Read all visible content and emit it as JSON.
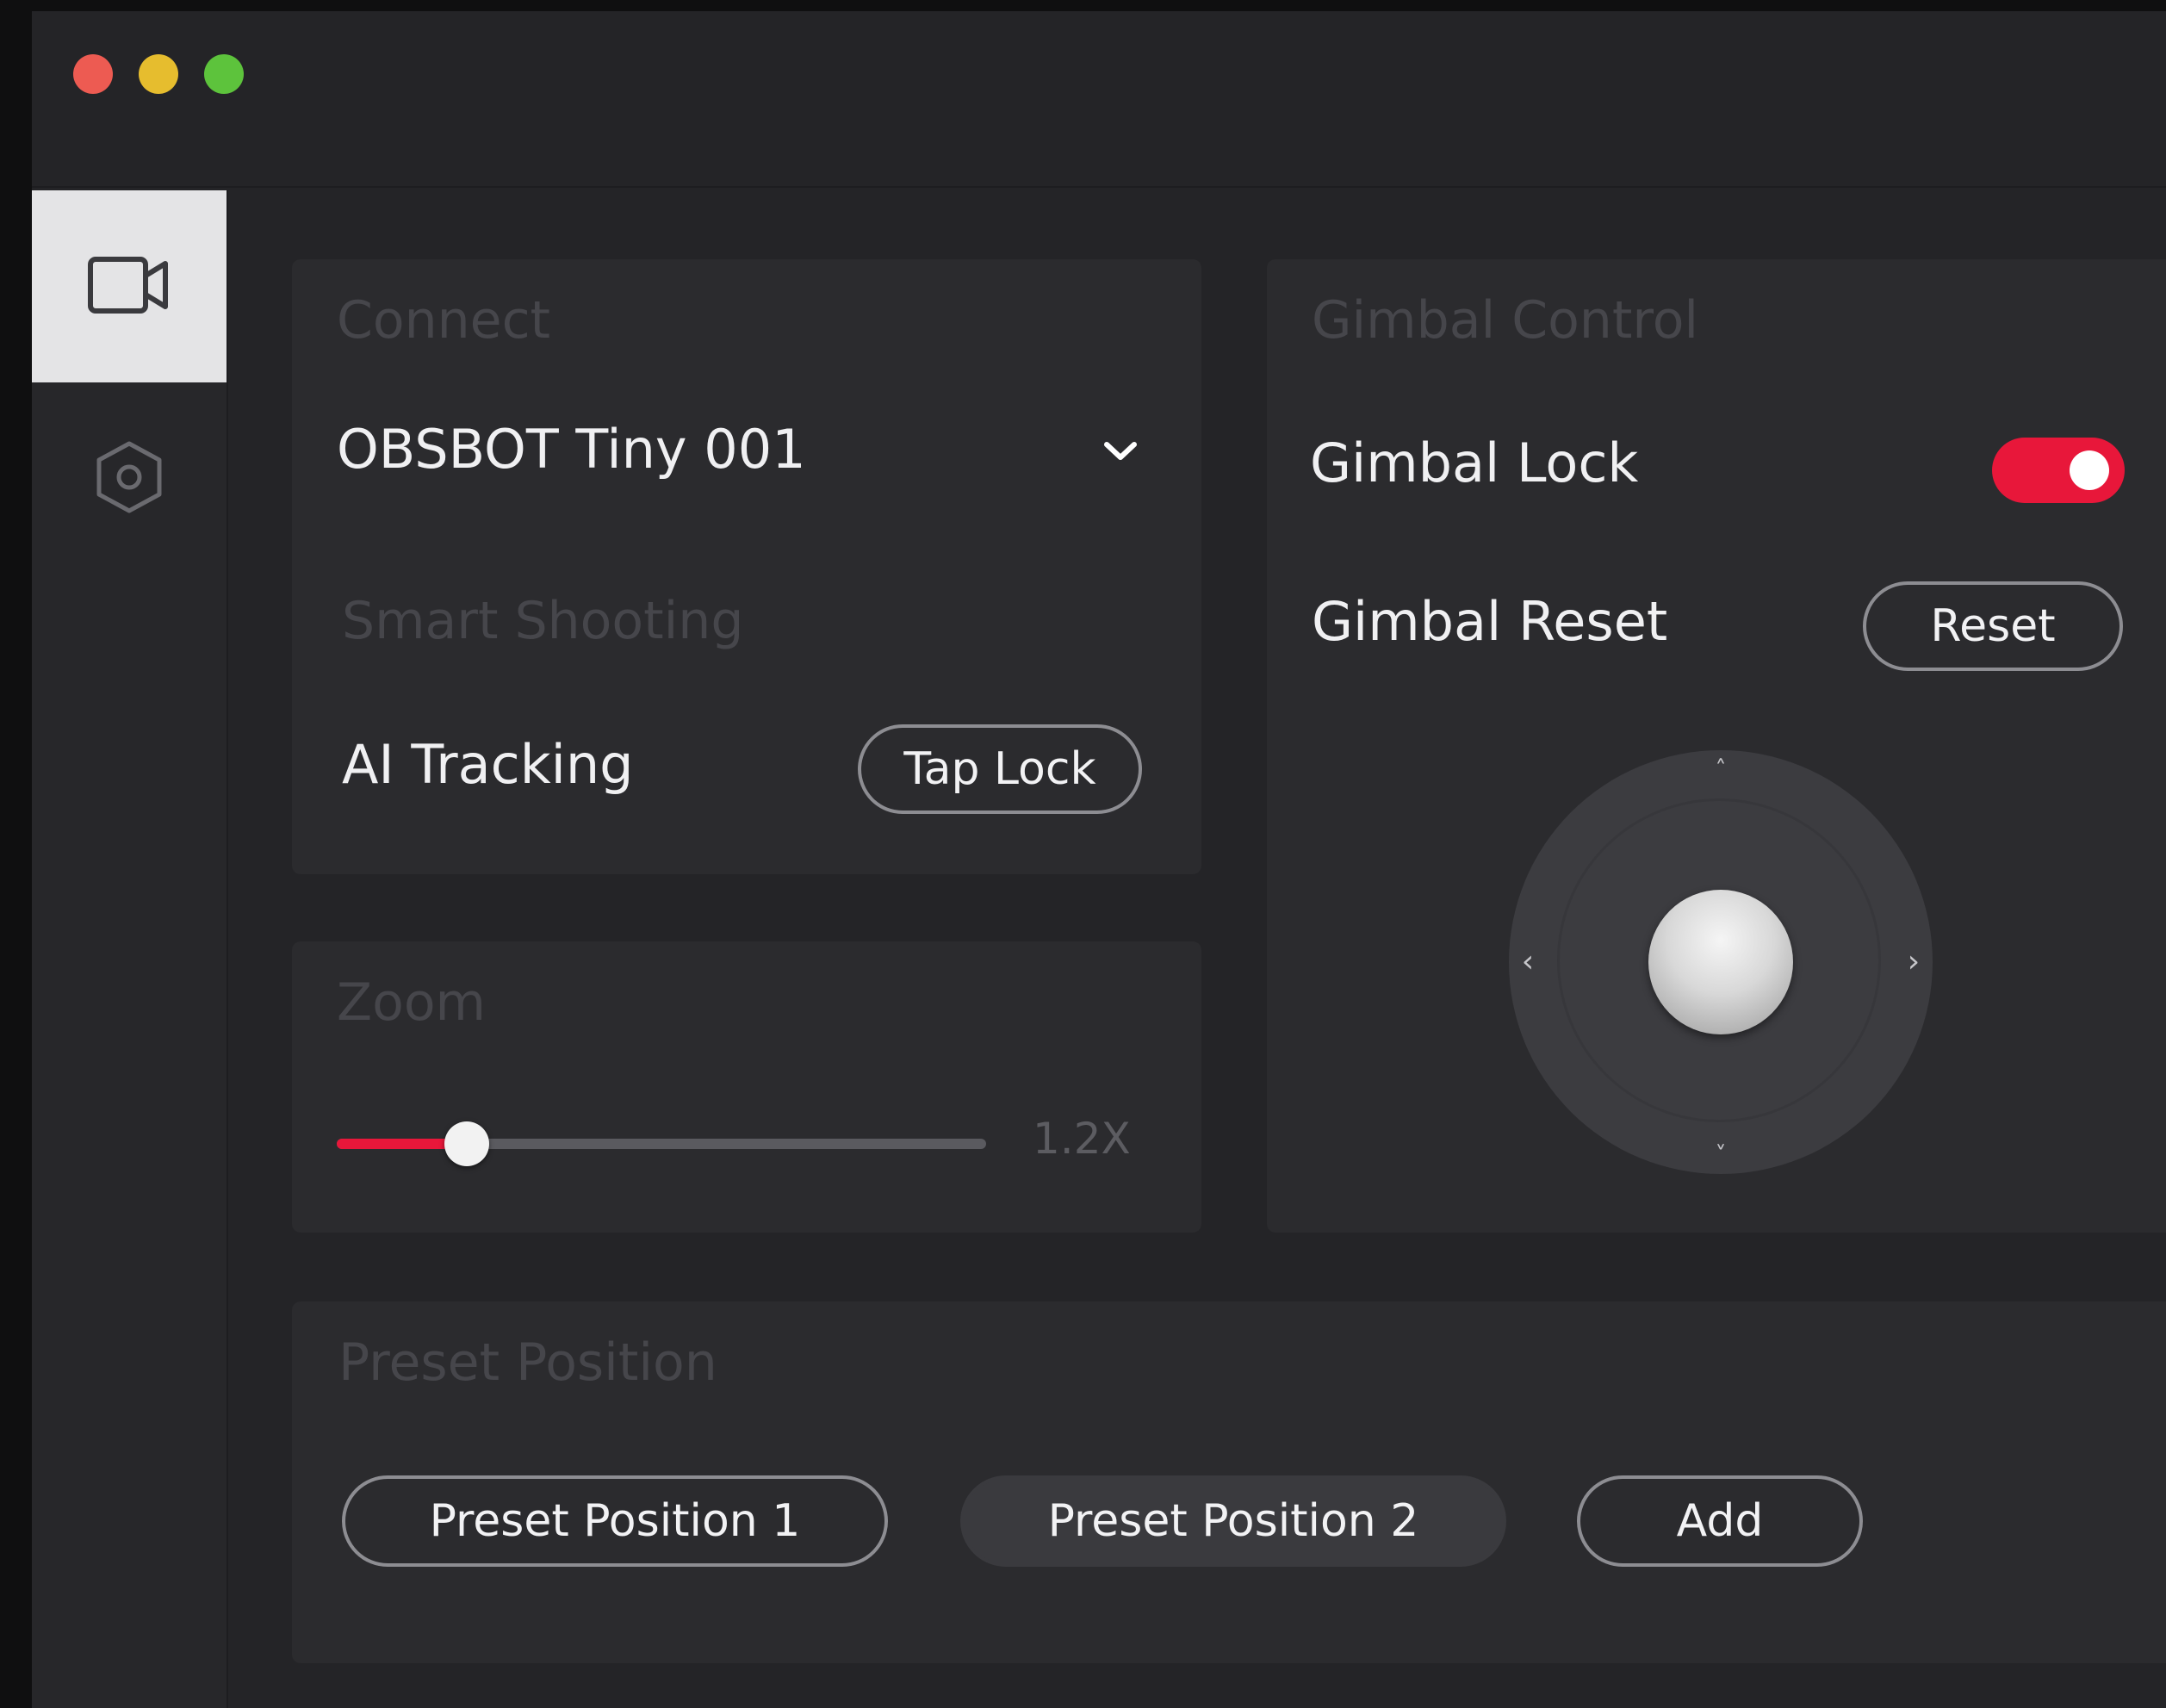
{
  "window": {
    "traffic_lights": {
      "close_color": "#ed5b52",
      "minimize_color": "#e6bd2e",
      "maximize_color": "#5dc33c"
    }
  },
  "colors": {
    "accent": "#e8173a",
    "active_sidebar_bg": "#e4e4e6"
  },
  "sidebar": {
    "items": [
      {
        "icon": "camera-icon",
        "active": true
      },
      {
        "icon": "settings-hexagon-icon",
        "active": false
      }
    ]
  },
  "connect": {
    "title": "Connect",
    "device_selected": "OBSBOT Tiny 001",
    "smart_shooting_title": "Smart Shooting",
    "ai_tracking_label": "AI Tracking",
    "tap_lock_label": "Tap Lock"
  },
  "zoom": {
    "title": "Zoom",
    "value_label": "1.2X",
    "value_fraction": 0.2
  },
  "gimbal": {
    "title": "Gimbal Control",
    "lock_label": "Gimbal Lock",
    "lock_on": true,
    "reset_label_text": "Gimbal Reset",
    "reset_button": "Reset",
    "arrows": {
      "up": "˄",
      "down": "˅",
      "left": "‹",
      "right": "›"
    }
  },
  "preset": {
    "title": "Preset Position",
    "buttons": [
      "Preset Position 1",
      "Preset Position 2"
    ],
    "add_label": "Add"
  }
}
